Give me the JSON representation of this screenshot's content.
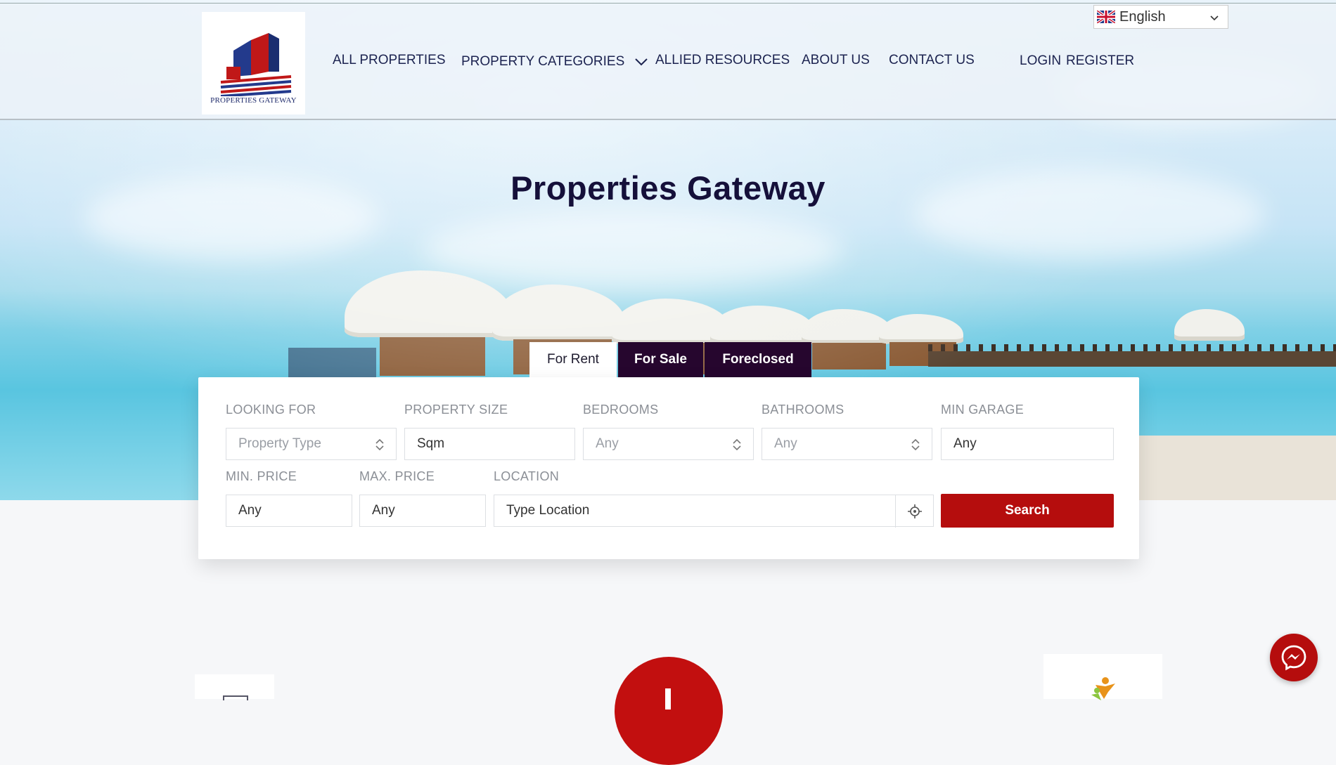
{
  "brand": {
    "logo_text": "PROPERTIES GATEWAY"
  },
  "nav": {
    "all_properties": "ALL PROPERTIES",
    "property_categories": "PROPERTY CATEGORIES",
    "allied_resources": "ALLIED RESOURCES",
    "about_us": "ABOUT US",
    "contact_us": "CONTACT US",
    "login": "LOGIN",
    "register": "REGISTER"
  },
  "language": {
    "selected": "English"
  },
  "hero": {
    "title": "Properties Gateway"
  },
  "tabs": [
    {
      "label": "For Rent",
      "active": true
    },
    {
      "label": "For Sale",
      "active": false
    },
    {
      "label": "Foreclosed",
      "active": false
    }
  ],
  "search": {
    "looking_for": {
      "label": "LOOKING FOR",
      "value": "Property Type"
    },
    "property_size": {
      "label": "PROPERTY SIZE",
      "value": "Sqm"
    },
    "bedrooms": {
      "label": "BEDROOMS",
      "value": "Any"
    },
    "bathrooms": {
      "label": "BATHROOMS",
      "value": "Any"
    },
    "min_garage": {
      "label": "MIN GARAGE",
      "value": "Any"
    },
    "min_price": {
      "label": "MIN. PRICE",
      "value": "Any"
    },
    "max_price": {
      "label": "MAX. PRICE",
      "value": "Any"
    },
    "location": {
      "label": "LOCATION",
      "placeholder": "Type Location"
    },
    "button_label": "Search"
  },
  "colors": {
    "accent_red": "#b50d0d",
    "dark_purple": "#26062e",
    "nav_text": "#1c2350"
  },
  "icons": [
    "uk-flag-icon",
    "chevron-down-icon",
    "up-down-icon",
    "crosshair-icon",
    "messenger-icon"
  ]
}
